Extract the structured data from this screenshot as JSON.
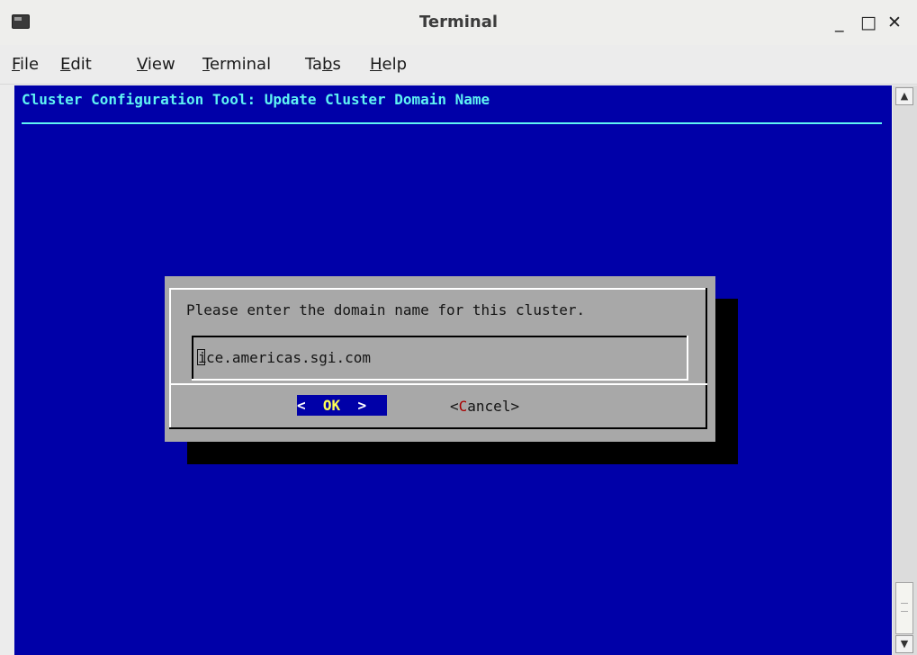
{
  "window": {
    "title": "Terminal",
    "minimize_icon": "minimize-icon",
    "maximize_icon": "maximize-icon",
    "close_icon": "close-icon",
    "minimize_glyph": "_",
    "maximize_glyph": "□",
    "close_glyph": "✕"
  },
  "menubar": {
    "items": [
      {
        "first": "F",
        "rest": "ile"
      },
      {
        "first": "E",
        "rest": "dit"
      },
      {
        "first": "V",
        "rest": "iew"
      },
      {
        "first": "T",
        "rest": "erminal"
      },
      {
        "pre": "Ta",
        "first": "b",
        "rest": "s"
      },
      {
        "first": "H",
        "rest": "elp"
      }
    ]
  },
  "terminal": {
    "background": "#0000a8",
    "header_color": "#5ff3f3",
    "header": "Cluster Configuration Tool: Update Cluster Domain Name",
    "dialog": {
      "prompt": "Please enter the domain name for this cluster.",
      "input_first_char": "i",
      "input_rest": "ce.americas.sgi.com",
      "ok_left": "<  ",
      "ok_hot": "OK",
      "ok_right": "  >",
      "cancel_left": "<",
      "cancel_hot": "C",
      "cancel_right": "ancel>"
    }
  },
  "scrollbar": {
    "up_glyph": "▲",
    "down_glyph": "▼"
  }
}
